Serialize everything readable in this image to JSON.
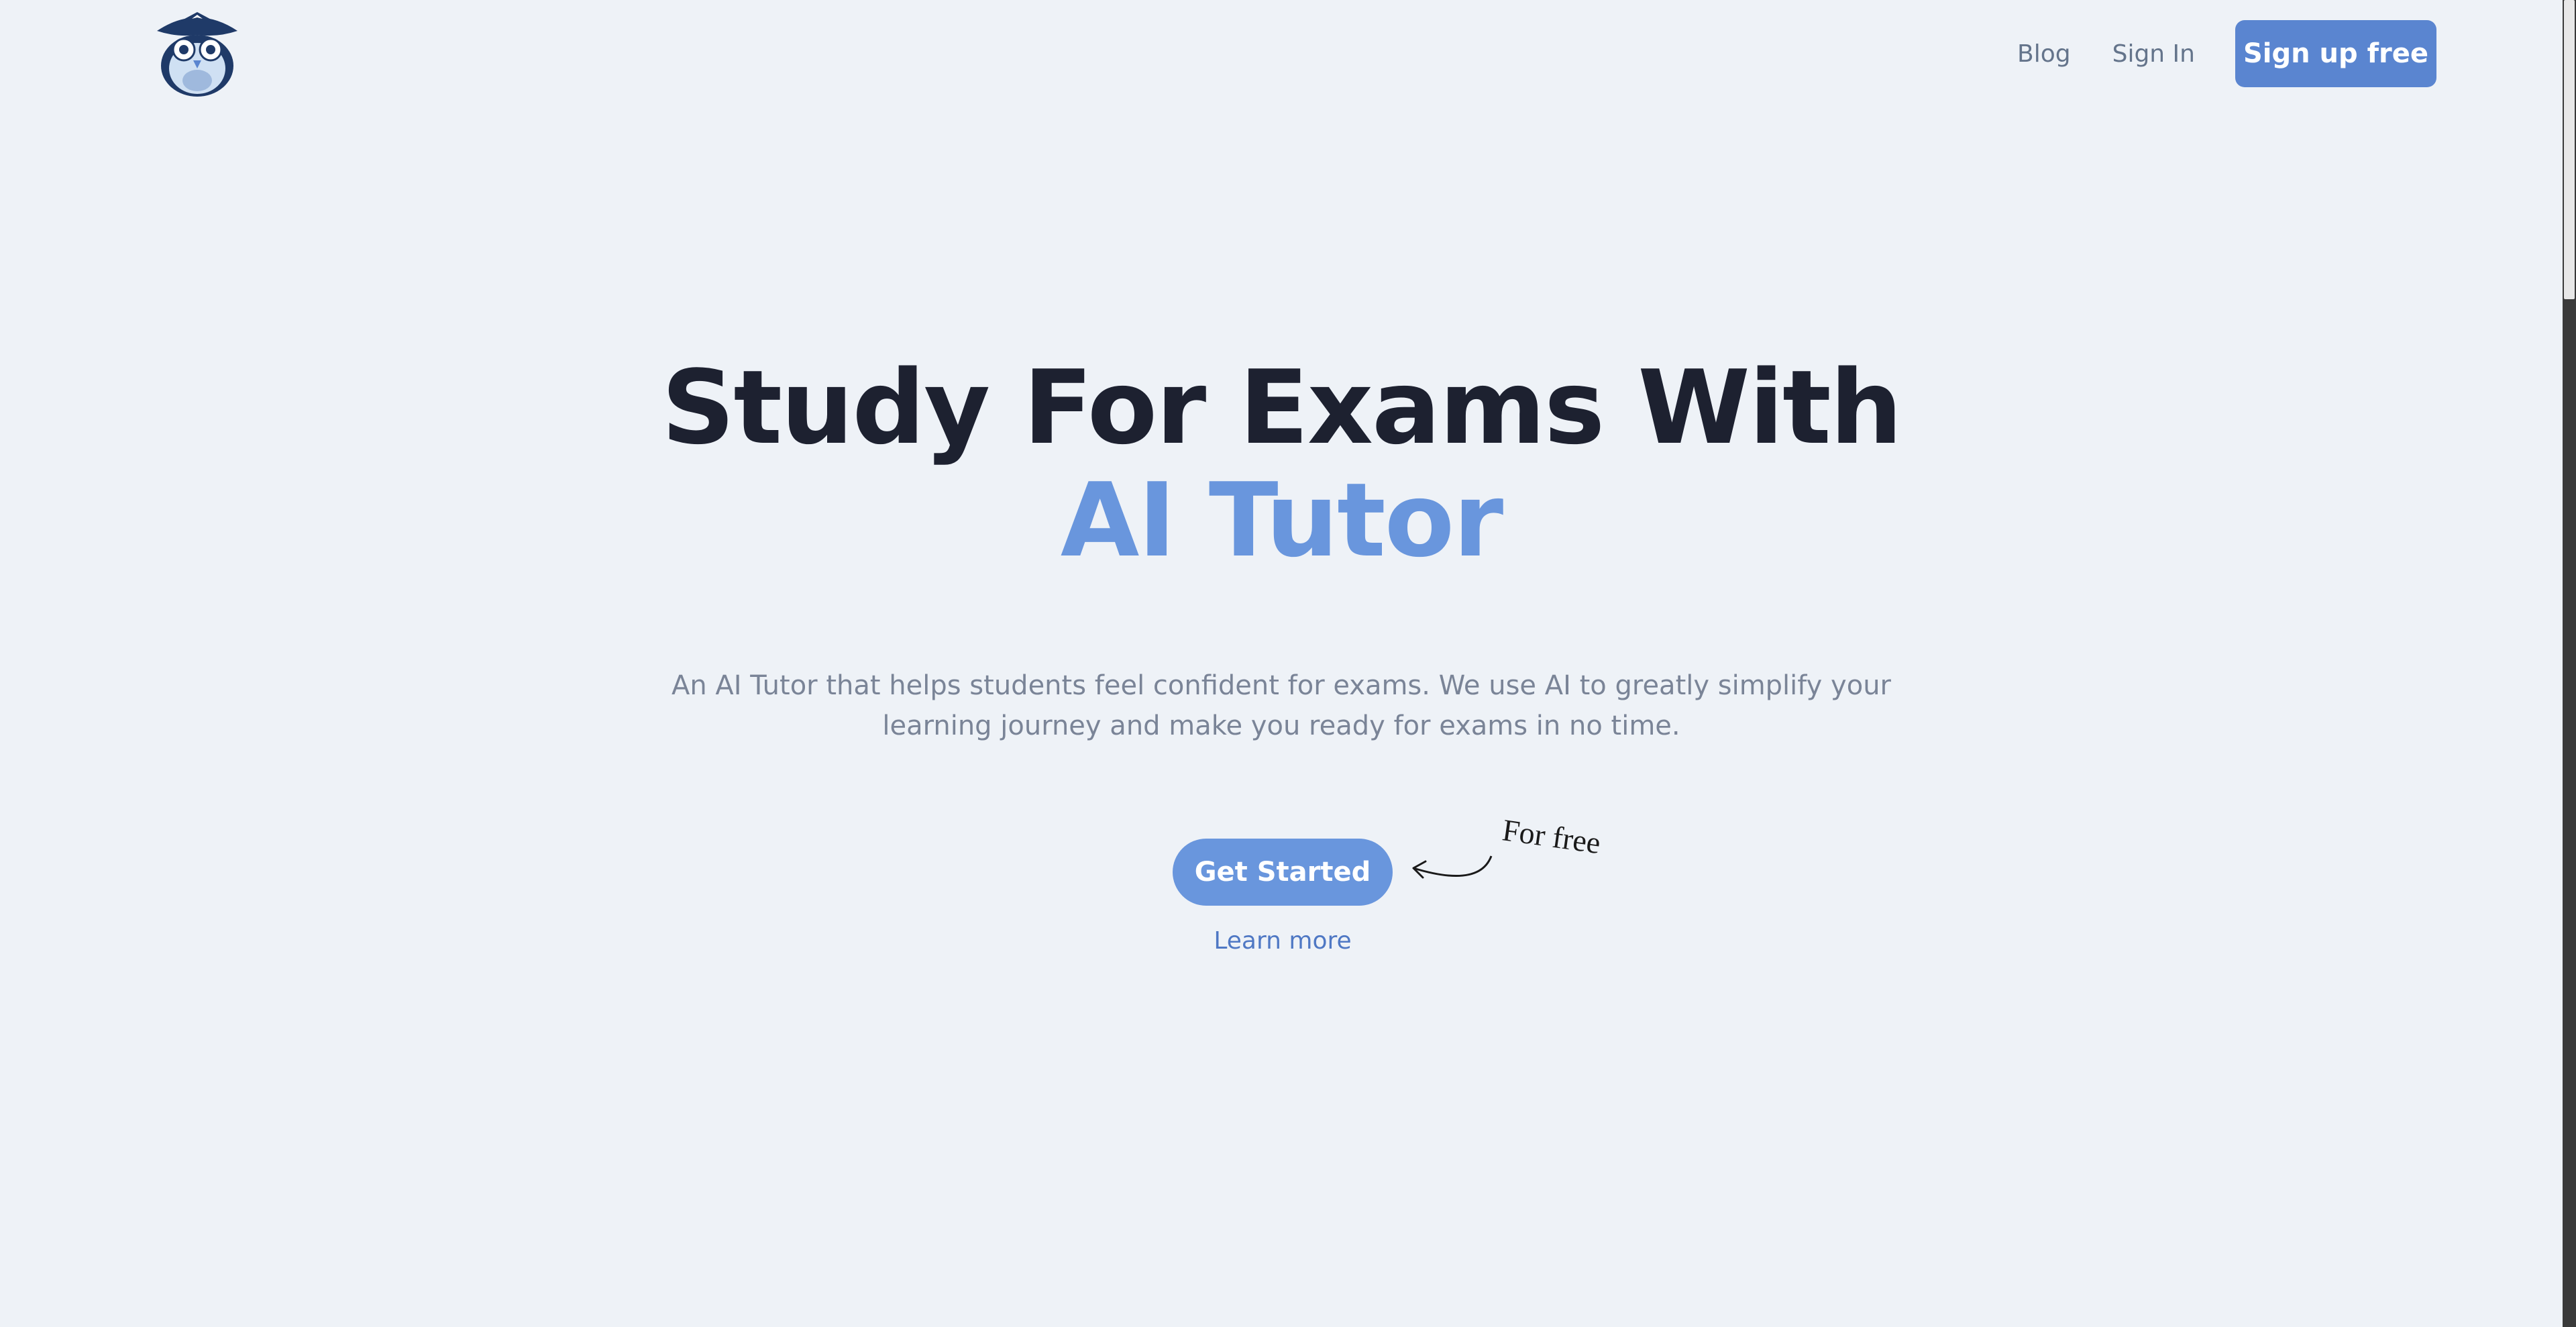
{
  "header": {
    "logo_icon": "owl-pirate-logo-icon",
    "nav": {
      "blog_label": "Blog",
      "signin_label": "Sign In",
      "signup_label": "Sign up free"
    }
  },
  "hero": {
    "title_line1": "Study For Exams With",
    "title_line2": "AI Tutor",
    "subtitle": "An AI Tutor that helps students feel confident for exams. We use AI to greatly simplify your learning journey and make you ready for exams in no time.",
    "cta_label": "Get Started",
    "learn_more_label": "Learn more",
    "annotation": "For free"
  },
  "colors": {
    "background": "#eef2f7",
    "accent": "#6996dd",
    "button": "#5a85d0",
    "heading": "#1d2130"
  }
}
